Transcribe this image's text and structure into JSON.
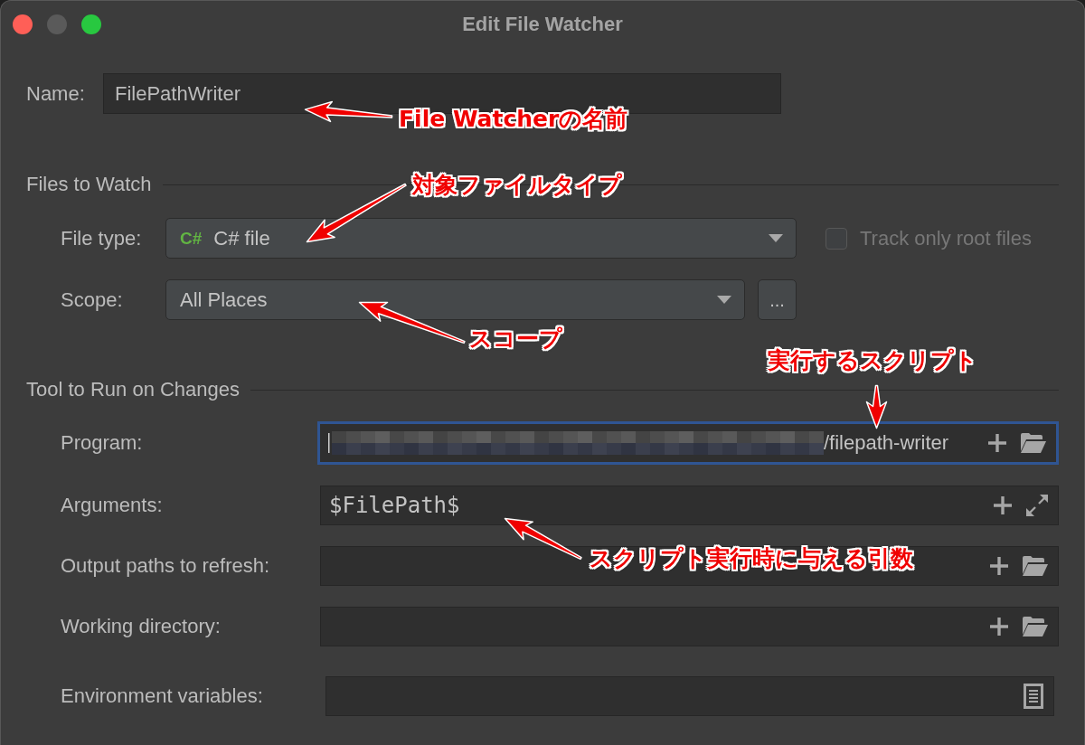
{
  "window": {
    "title": "Edit File Watcher",
    "controls": [
      {
        "kind": "close",
        "disabled": false
      },
      {
        "kind": "minimize",
        "disabled": true
      },
      {
        "kind": "zoom",
        "disabled": false
      }
    ]
  },
  "name": {
    "label": "Name:",
    "value": "FilePathWriter"
  },
  "files_to_watch": {
    "heading": "Files to Watch",
    "file_type": {
      "label": "File type:",
      "icon_text": "C#",
      "value": "C# file"
    },
    "track_only_root_files": {
      "label": "Track only root files",
      "checked": false,
      "disabled": true
    },
    "scope": {
      "label": "Scope:",
      "value": "All Places",
      "browse_button": "..."
    }
  },
  "tool_to_run": {
    "heading": "Tool to Run on Changes",
    "fields": [
      {
        "kind": "path",
        "label": "Program:",
        "value": "/filepath-writer",
        "redacted": true,
        "focused": true
      },
      {
        "kind": "arguments",
        "label": "Arguments:",
        "value": "$FilePath$",
        "redacted": false,
        "focused": false
      },
      {
        "kind": "path",
        "label": "Output paths to refresh:",
        "redacted": false,
        "focused": false
      },
      {
        "kind": "path",
        "label": "Working directory:",
        "redacted": false,
        "focused": false
      },
      {
        "kind": "environment",
        "label": "Environment variables:",
        "redacted": false,
        "focused": false
      }
    ]
  },
  "annotations": [
    {
      "text": "File Watcherの名前"
    },
    {
      "text": "対象ファイルタイプ"
    },
    {
      "text": "スコープ"
    },
    {
      "text": "実行するスクリプト"
    },
    {
      "text": "スクリプト実行時に与える引数"
    }
  ]
}
